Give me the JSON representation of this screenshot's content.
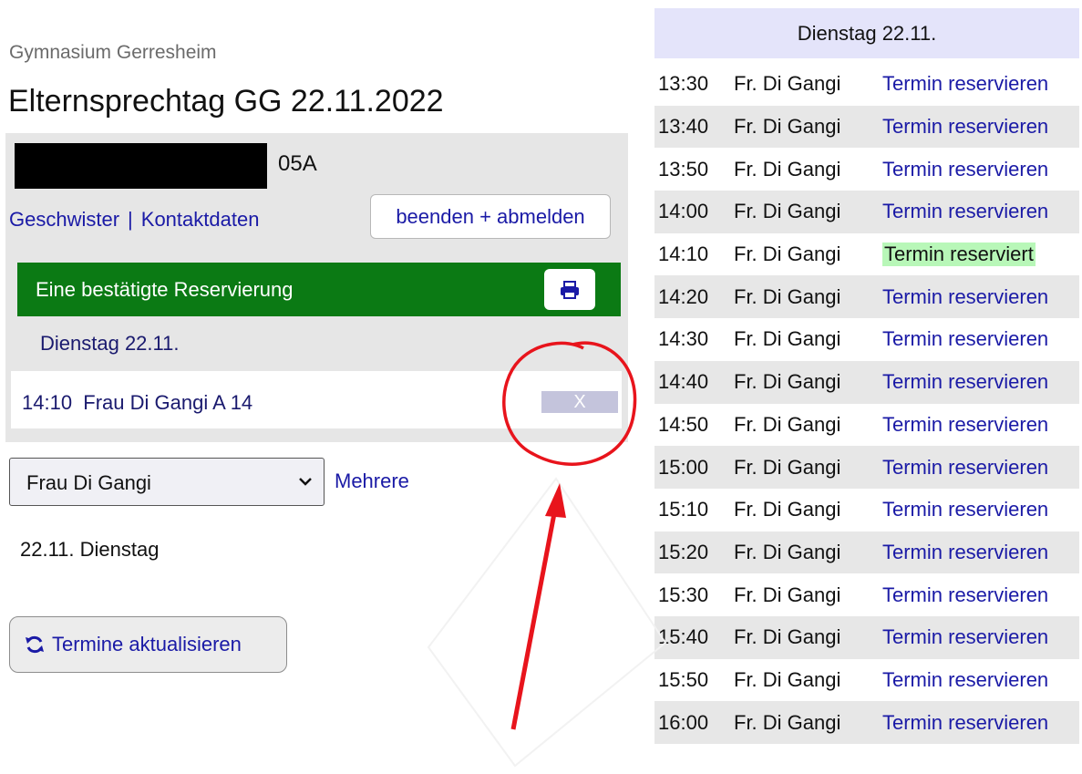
{
  "header": {
    "school": "Gymnasium Gerresheim",
    "title": "Elternsprechtag GG 22.11.2022"
  },
  "student": {
    "class": "05A"
  },
  "links": {
    "siblings": "Geschwister",
    "separator": "|",
    "contact": "Kontaktdaten"
  },
  "end_button": "beenden + abmelden",
  "confirmation": {
    "text": "Eine bestätigte Reservierung"
  },
  "reservation": {
    "day": "Dienstag 22.11.",
    "entry": "14:10  Frau Di Gangi A 14",
    "cancel_label": "X"
  },
  "teacher_select": {
    "value": "Frau Di Gangi"
  },
  "multiple_link": "Mehrere",
  "date_line": "22.11. Dienstag",
  "refresh_button": "Termine aktualisieren",
  "schedule": {
    "day": "Dienstag 22.11.",
    "slots": [
      {
        "time": "13:30",
        "teacher": "Fr. Di Gangi",
        "action": "Termin reservieren"
      },
      {
        "time": "13:40",
        "teacher": "Fr. Di Gangi",
        "action": "Termin reservieren"
      },
      {
        "time": "13:50",
        "teacher": "Fr. Di Gangi",
        "action": "Termin reservieren"
      },
      {
        "time": "14:00",
        "teacher": "Fr. Di Gangi",
        "action": "Termin reservieren"
      },
      {
        "time": "14:10",
        "teacher": "Fr. Di Gangi",
        "action": "Termin reserviert"
      },
      {
        "time": "14:20",
        "teacher": "Fr. Di Gangi",
        "action": "Termin reservieren"
      },
      {
        "time": "14:30",
        "teacher": "Fr. Di Gangi",
        "action": "Termin reservieren"
      },
      {
        "time": "14:40",
        "teacher": "Fr. Di Gangi",
        "action": "Termin reservieren"
      },
      {
        "time": "14:50",
        "teacher": "Fr. Di Gangi",
        "action": "Termin reservieren"
      },
      {
        "time": "15:00",
        "teacher": "Fr. Di Gangi",
        "action": "Termin reservieren"
      },
      {
        "time": "15:10",
        "teacher": "Fr. Di Gangi",
        "action": "Termin reservieren"
      },
      {
        "time": "15:20",
        "teacher": "Fr. Di Gangi",
        "action": "Termin reservieren"
      },
      {
        "time": "15:30",
        "teacher": "Fr. Di Gangi",
        "action": "Termin reservieren"
      },
      {
        "time": "15:40",
        "teacher": "Fr. Di Gangi",
        "action": "Termin reservieren"
      },
      {
        "time": "15:50",
        "teacher": "Fr. Di Gangi",
        "action": "Termin reservieren"
      },
      {
        "time": "16:00",
        "teacher": "Fr. Di Gangi",
        "action": "Termin reservieren"
      }
    ]
  },
  "colors": {
    "link": "#1a1aa6",
    "confirm_green": "#0b7a14",
    "reserved_bg": "#b8f7b8",
    "annotation_red": "#e8141c"
  },
  "icons": {
    "print": "printer-icon",
    "refresh": "refresh-icon",
    "select": "chevron-down-icon"
  }
}
